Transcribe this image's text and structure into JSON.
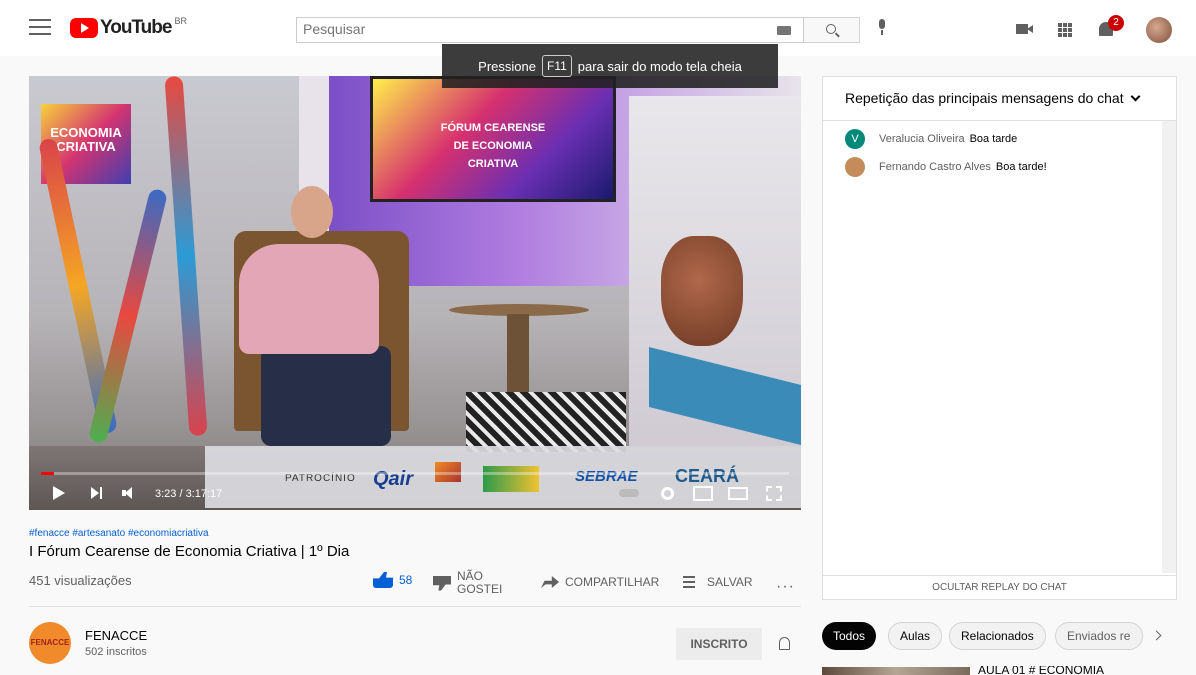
{
  "masthead": {
    "logo_text": "YouTube",
    "region": "BR",
    "search_placeholder": "Pesquisar",
    "notification_count": "2"
  },
  "toast": {
    "prefix": "Pressione",
    "key": "F11",
    "suffix": "para sair do modo tela cheia"
  },
  "player": {
    "time": "3:23 / 3:17:17",
    "progress_fraction": 0.017,
    "overlay_logo": "ECONOMIA CRIATIVA",
    "screen_text": "FÓRUM CEARENSE DE ECONOMIA CRIATIVA",
    "sponsor_label": "PATROCÍNIO",
    "sponsors": [
      "Qair",
      "MARQUISE",
      "ADECE BRASIL",
      "SEBRAE",
      "CEARÁ"
    ]
  },
  "video": {
    "hashtags": "#fenacce #artesanato #economiacriativa",
    "title": "I Fórum Cearense de Economia Criativa | 1º Dia",
    "views": "451 visualizações",
    "likes": "58",
    "dislike_label_1": "NÃO",
    "dislike_label_2": "GOSTEI",
    "share_label": "COMPARTILHAR",
    "save_label": "SALVAR",
    "more": "···"
  },
  "channel": {
    "avatar_text": "FENACCE",
    "name": "FENACCE",
    "subscribers": "502 inscritos",
    "subscribe_label": "INSCRITO"
  },
  "chat": {
    "header": "Repetição das principais mensagens do chat",
    "messages": [
      {
        "initial": "V",
        "author": "Veralucia Oliveira",
        "text": "Boa tarde",
        "color": "#00897b"
      },
      {
        "initial": "",
        "author": "Fernando Castro Alves",
        "text": "Boa tarde!",
        "color": "#c58b5a"
      }
    ],
    "footer": "OCULTAR REPLAY DO CHAT"
  },
  "chips": [
    "Todos",
    "Aulas",
    "Relacionados",
    "Enviados re"
  ],
  "recommendation": {
    "title": "AULA 01 # ECONOMIA"
  },
  "colors": {
    "brand_red": "#ff0000",
    "link_blue": "#065fd4",
    "badge_red": "#cc0000"
  }
}
